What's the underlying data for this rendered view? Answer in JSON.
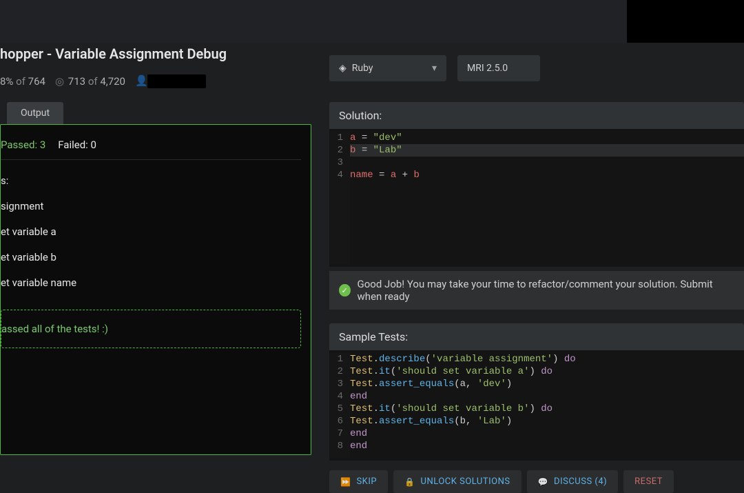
{
  "kata": {
    "title": "hopper - Variable Assignment Debug",
    "completion_pct": "8%",
    "completion_total": "764",
    "solutions_done": "713",
    "solutions_total": "4,720"
  },
  "language": {
    "name": "Ruby",
    "runtime": "MRI 2.5.0"
  },
  "tabs": {
    "output": "Output"
  },
  "results": {
    "passed_label": "Passed:",
    "passed_count": "3",
    "failed_label": "Failed:",
    "failed_count": "0",
    "heading": "s:",
    "items": [
      "signment",
      "et variable a",
      "et variable b",
      "et variable name"
    ],
    "success": "assed all of the tests! :)"
  },
  "solution": {
    "header": "Solution:",
    "lines": [
      {
        "n": "1",
        "html": "<span class='s-id'>a</span> <span class='s-op'>=</span> <span class='s-str'>\"dev\"</span>"
      },
      {
        "n": "2",
        "html": "<span class='hlrow'><span class='s-id'>b</span> <span class='s-op'>=</span> <span class='s-str'>\"Lab\"</span></span>"
      },
      {
        "n": "3",
        "html": ""
      },
      {
        "n": "4",
        "html": "<span class='s-id'>name</span> <span class='s-op'>=</span> <span class='s-id'>a</span> <span class='s-op'>+</span> <span class='s-id'>b</span>"
      }
    ]
  },
  "good_job": "Good Job! You may take your time to refactor/comment your solution. Submit when ready",
  "tests": {
    "header": "Sample Tests:",
    "lines": [
      {
        "n": "1",
        "html": "<span class='s-cls'>Test</span>.<span class='s-fn'>describe</span>(<span class='s-str'>'variable assignment'</span>) <span class='s-kw'>do</span>"
      },
      {
        "n": "2",
        "html": "<span class='s-cls'>Test</span>.<span class='s-fn'>it</span>(<span class='s-str'>'should set variable a'</span>) <span class='s-kw'>do</span>"
      },
      {
        "n": "3",
        "html": "<span class='s-cls'>Test</span>.<span class='s-fn'>assert_equals</span>(a, <span class='s-str'>'dev'</span>)"
      },
      {
        "n": "4",
        "html": "<span class='s-kw'>end</span>"
      },
      {
        "n": "5",
        "html": "<span class='s-cls'>Test</span>.<span class='s-fn'>it</span>(<span class='s-str'>'should set variable b'</span>) <span class='s-kw'>do</span>"
      },
      {
        "n": "6",
        "html": "<span class='s-cls'>Test</span>.<span class='s-fn'>assert_equals</span>(b, <span class='s-str'>'Lab'</span>)"
      },
      {
        "n": "7",
        "html": "<span class='s-kw'>end</span>"
      },
      {
        "n": "8",
        "html": "<span class='s-kw'>end</span>"
      }
    ]
  },
  "buttons": {
    "skip": "SKIP",
    "unlock": "UNLOCK SOLUTIONS",
    "discuss": "DISCUSS (4)",
    "reset": "RESET"
  }
}
